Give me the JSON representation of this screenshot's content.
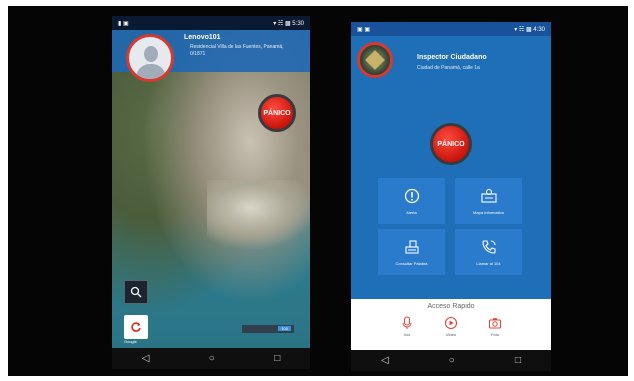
{
  "left_phone": {
    "status_left": "▮ ▣",
    "status_right": "▾ ☵ ▩ 5:30",
    "user_name": "Lenovo101",
    "user_address": "Residencial Villa de las Fuentes, Panamá, 0/1871",
    "panic_label": "PÁNICO",
    "zoom_value": "100",
    "map_credit": "Google",
    "nav": [
      "◁",
      "○",
      "□"
    ]
  },
  "right_phone": {
    "status_left": "▣ ▣",
    "status_right": "▾ ☵ ▩ 4:30",
    "app_title": "Inspector Ciudadano",
    "app_subtitle": "Ciudad de Panamá, calle 1a",
    "panic_label": "PÁNICO",
    "tiles": [
      {
        "label": "Alerta",
        "icon": "alert-icon"
      },
      {
        "label": "Mapa Informativo",
        "icon": "map-info-icon"
      },
      {
        "label": "Consultar Palabra",
        "icon": "consult-icon"
      },
      {
        "label": "Llamar al 104",
        "icon": "phone-icon"
      }
    ],
    "quick_title": "Acceso Rapido",
    "quick_items": [
      "Voz",
      "Video",
      "Foto"
    ],
    "nav": [
      "◁",
      "○",
      "□"
    ]
  },
  "colors": {
    "primary_blue": "#1f6fb8",
    "tile_blue": "#2a7bcb",
    "panic_red": "#d62a1f",
    "quick_red": "#e0463a"
  }
}
